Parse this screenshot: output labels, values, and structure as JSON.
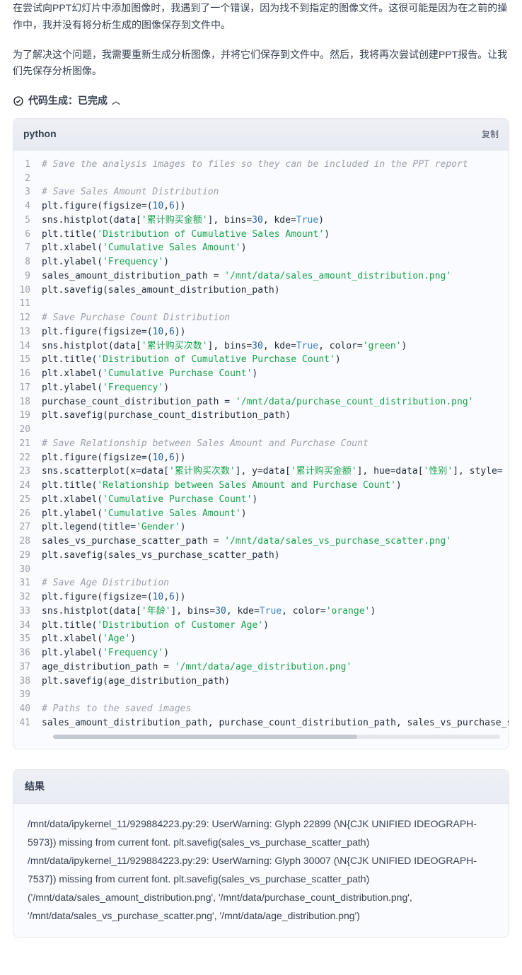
{
  "paragraphs": {
    "p1": "在尝试向PPT幻灯片中添加图像时，我遇到了一个错误，因为找不到指定的图像文件。这很可能是因为在之前的操作中，我并没有将分析生成的图像保存到文件中。",
    "p2": "为了解决这个问题，我需要重新生成分析图像，并将它们保存到文件中。然后，我将再次尝试创建PPT报告。让我们先保存分析图像。"
  },
  "status": {
    "label": "代码生成：已完成"
  },
  "code_header": {
    "lang": "python",
    "copy": "复制"
  },
  "code_text": {
    "l1": "# Save the analysis images to files so they can be included in the PPT report",
    "l3": "# Save Sales Amount Distribution",
    "l4a": "plt.figure(figsize=(",
    "l4b": "10",
    "l4c": ",",
    "l4d": "6",
    "l4e": "))",
    "l5a": "sns.histplot(data[",
    "l5b": "'累计购买金额'",
    "l5c": "], bins=",
    "l5d": "30",
    "l5e": ", kde=",
    "l5f": "True",
    "l5g": ")",
    "l6a": "plt.title(",
    "l6b": "'Distribution of Cumulative Sales Amount'",
    "l6c": ")",
    "l7a": "plt.xlabel(",
    "l7b": "'Cumulative Sales Amount'",
    "l7c": ")",
    "l8a": "plt.ylabel(",
    "l8b": "'Frequency'",
    "l8c": ")",
    "l9a": "sales_amount_distribution_path = ",
    "l9b": "'/mnt/data/sales_amount_distribution.png'",
    "l10": "plt.savefig(sales_amount_distribution_path)",
    "l12": "# Save Purchase Count Distribution",
    "l13a": "plt.figure(figsize=(",
    "l13b": "10",
    "l13c": ",",
    "l13d": "6",
    "l13e": "))",
    "l14a": "sns.histplot(data[",
    "l14b": "'累计购买次数'",
    "l14c": "], bins=",
    "l14d": "30",
    "l14e": ", kde=",
    "l14f": "True",
    "l14g": ", color=",
    "l14h": "'green'",
    "l14i": ")",
    "l15a": "plt.title(",
    "l15b": "'Distribution of Cumulative Purchase Count'",
    "l15c": ")",
    "l16a": "plt.xlabel(",
    "l16b": "'Cumulative Purchase Count'",
    "l16c": ")",
    "l17a": "plt.ylabel(",
    "l17b": "'Frequency'",
    "l17c": ")",
    "l18a": "purchase_count_distribution_path = ",
    "l18b": "'/mnt/data/purchase_count_distribution.png'",
    "l19": "plt.savefig(purchase_count_distribution_path)",
    "l21": "# Save Relationship between Sales Amount and Purchase Count",
    "l22a": "plt.figure(figsize=(",
    "l22b": "10",
    "l22c": ",",
    "l22d": "6",
    "l22e": "))",
    "l23a": "sns.scatterplot(x=data[",
    "l23b": "'累计购买次数'",
    "l23c": "], y=data[",
    "l23d": "'累计购买金额'",
    "l23e": "], hue=data[",
    "l23f": "'性别'",
    "l23g": "], style=",
    "l24a": "plt.title(",
    "l24b": "'Relationship between Sales Amount and Purchase Count'",
    "l24c": ")",
    "l25a": "plt.xlabel(",
    "l25b": "'Cumulative Purchase Count'",
    "l25c": ")",
    "l26a": "plt.ylabel(",
    "l26b": "'Cumulative Sales Amount'",
    "l26c": ")",
    "l27a": "plt.legend(title=",
    "l27b": "'Gender'",
    "l27c": ")",
    "l28a": "sales_vs_purchase_scatter_path = ",
    "l28b": "'/mnt/data/sales_vs_purchase_scatter.png'",
    "l29": "plt.savefig(sales_vs_purchase_scatter_path)",
    "l31": "# Save Age Distribution",
    "l32a": "plt.figure(figsize=(",
    "l32b": "10",
    "l32c": ",",
    "l32d": "6",
    "l32e": "))",
    "l33a": "sns.histplot(data[",
    "l33b": "'年龄'",
    "l33c": "], bins=",
    "l33d": "30",
    "l33e": ", kde=",
    "l33f": "True",
    "l33g": ", color=",
    "l33h": "'orange'",
    "l33i": ")",
    "l34a": "plt.title(",
    "l34b": "'Distribution of Customer Age'",
    "l34c": ")",
    "l35a": "plt.xlabel(",
    "l35b": "'Age'",
    "l35c": ")",
    "l36a": "plt.ylabel(",
    "l36b": "'Frequency'",
    "l36c": ")",
    "l37a": "age_distribution_path = ",
    "l37b": "'/mnt/data/age_distribution.png'",
    "l38": "plt.savefig(age_distribution_path)",
    "l40": "# Paths to the saved images",
    "l41": "sales_amount_distribution_path, purchase_count_distribution_path, sales_vs_purchase_s"
  },
  "line_numbers": {
    "n1": "1",
    "n2": "2",
    "n3": "3",
    "n4": "4",
    "n5": "5",
    "n6": "6",
    "n7": "7",
    "n8": "8",
    "n9": "9",
    "n10": "10",
    "n11": "11",
    "n12": "12",
    "n13": "13",
    "n14": "14",
    "n15": "15",
    "n16": "16",
    "n17": "17",
    "n18": "18",
    "n19": "19",
    "n20": "20",
    "n21": "21",
    "n22": "22",
    "n23": "23",
    "n24": "24",
    "n25": "25",
    "n26": "26",
    "n27": "27",
    "n28": "28",
    "n29": "29",
    "n30": "30",
    "n31": "31",
    "n32": "32",
    "n33": "33",
    "n34": "34",
    "n35": "35",
    "n36": "36",
    "n37": "37",
    "n38": "38",
    "n39": "39",
    "n40": "40",
    "n41": "41"
  },
  "result": {
    "title": "结果",
    "lines": {
      "r1": "/mnt/data/ipykernel_11/929884223.py:29: UserWarning: Glyph 22899 (\\N{CJK UNIFIED IDEOGRAPH-5973}) missing from current font. plt.savefig(sales_vs_purchase_scatter_path)",
      "r2": "/mnt/data/ipykernel_11/929884223.py:29: UserWarning: Glyph 30007 (\\N{CJK UNIFIED IDEOGRAPH-7537}) missing from current font. plt.savefig(sales_vs_purchase_scatter_path)",
      "r3": "('/mnt/data/sales_amount_distribution.png', '/mnt/data/purchase_count_distribution.png', '/mnt/data/sales_vs_purchase_scatter.png', '/mnt/data/age_distribution.png')"
    }
  }
}
